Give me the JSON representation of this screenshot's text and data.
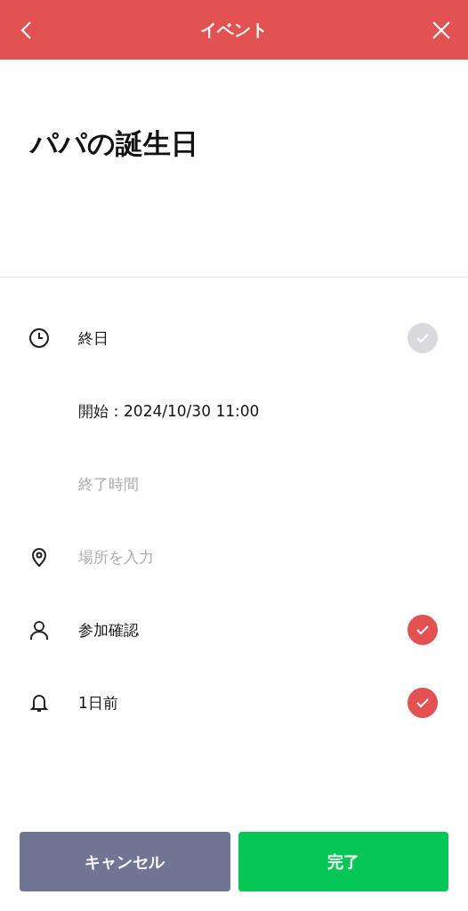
{
  "header": {
    "title": "イベント"
  },
  "event": {
    "title": "パパの誕生日"
  },
  "rows": [
    {
      "kind": "all_day",
      "label": "終日",
      "checked": false
    },
    {
      "kind": "start",
      "label": "開始：2024/10/30 11:00"
    },
    {
      "kind": "end",
      "placeholder": "終了時間"
    },
    {
      "kind": "location",
      "placeholder": "場所を入力"
    },
    {
      "kind": "attendance",
      "label": "参加確認",
      "checked": true
    },
    {
      "kind": "reminder",
      "label": "1日前",
      "checked": true
    }
  ],
  "buttons": [
    {
      "kind": "cancel",
      "label": "キャンセル"
    },
    {
      "kind": "done",
      "label": "完了"
    }
  ]
}
